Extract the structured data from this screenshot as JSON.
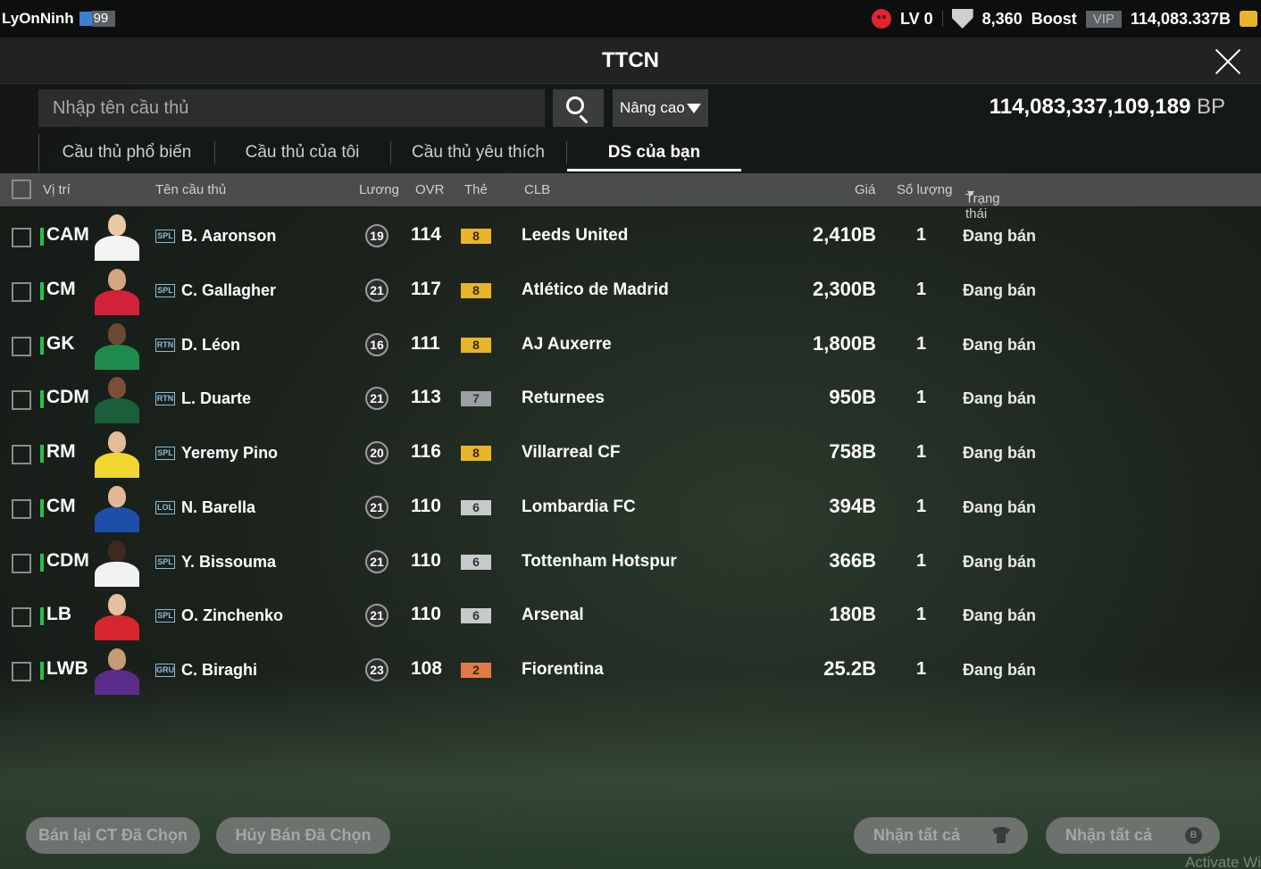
{
  "topbar": {
    "username": "LyOnNinh",
    "level": "99",
    "lv": "LV 0",
    "gift_count": "8,360",
    "boost": "Boost",
    "vip": "VIP",
    "coins": "114,083.337B"
  },
  "window": {
    "title": "TTCN"
  },
  "search": {
    "placeholder": "Nhập tên cầu thủ",
    "advanced": "Nâng cao"
  },
  "balance": {
    "value": "114,083,337,109,189",
    "unit": "BP"
  },
  "tabs": [
    "Cầu thủ phổ biến",
    "Cầu thủ của tôi",
    "Cầu thủ yêu thích",
    "DS của bạn"
  ],
  "active_tab": "DS của bạn",
  "columns": {
    "position": "Vị trí",
    "name": "Tên cầu thủ",
    "salary": "Lương",
    "ovr": "OVR",
    "card": "Thẻ",
    "club": "CLB",
    "price": "Giá",
    "quantity": "Số lượng",
    "status": "Trạng thái"
  },
  "rows": [
    {
      "position": "CAM",
      "season": "SPL",
      "name": "B. Aaronson",
      "salary": "19",
      "ovr": "114",
      "card": "8",
      "club": "Leeds United",
      "price": "2,410B",
      "quantity": "1",
      "status": "Đang bán"
    },
    {
      "position": "CM",
      "season": "SPL",
      "name": "C. Gallagher",
      "salary": "21",
      "ovr": "117",
      "card": "8",
      "club": "Atlético de Madrid",
      "price": "2,300B",
      "quantity": "1",
      "status": "Đang bán"
    },
    {
      "position": "GK",
      "season": "RTN",
      "name": "D. Léon",
      "salary": "16",
      "ovr": "111",
      "card": "8",
      "club": "AJ Auxerre",
      "price": "1,800B",
      "quantity": "1",
      "status": "Đang bán"
    },
    {
      "position": "CDM",
      "season": "RTN",
      "name": "L. Duarte",
      "salary": "21",
      "ovr": "113",
      "card": "7",
      "club": "Returnees",
      "price": "950B",
      "quantity": "1",
      "status": "Đang bán"
    },
    {
      "position": "RM",
      "season": "SPL",
      "name": "Yeremy Pino",
      "salary": "20",
      "ovr": "116",
      "card": "8",
      "club": "Villarreal CF",
      "price": "758B",
      "quantity": "1",
      "status": "Đang bán"
    },
    {
      "position": "CM",
      "season": "LOL",
      "name": "N. Barella",
      "salary": "21",
      "ovr": "110",
      "card": "6",
      "club": "Lombardia FC",
      "price": "394B",
      "quantity": "1",
      "status": "Đang bán"
    },
    {
      "position": "CDM",
      "season": "SPL",
      "name": "Y. Bissouma",
      "salary": "21",
      "ovr": "110",
      "card": "6",
      "club": "Tottenham Hotspur",
      "price": "366B",
      "quantity": "1",
      "status": "Đang bán"
    },
    {
      "position": "LB",
      "season": "SPL",
      "name": "O. Zinchenko",
      "salary": "21",
      "ovr": "110",
      "card": "6",
      "club": "Arsenal",
      "price": "180B",
      "quantity": "1",
      "status": "Đang bán"
    },
    {
      "position": "LWB",
      "season": "GRU",
      "name": "C. Biraghi",
      "salary": "23",
      "ovr": "108",
      "card": "2",
      "club": "Fiorentina",
      "price": "25.2B",
      "quantity": "1",
      "status": "Đang bán"
    }
  ],
  "card_colors": {
    "8": "#e8b52a",
    "7": "#9aa0a3",
    "6": "#c7cacb",
    "2": "#e07a4a"
  },
  "buttons": {
    "resell": "Bán lại CT Đã Chọn",
    "cancel_sale": "Hủy Bán Đã Chọn",
    "claim_all_players": "Nhận tất cả",
    "claim_all_bp": "Nhận tất cả"
  },
  "watermark": "Activate Wi"
}
